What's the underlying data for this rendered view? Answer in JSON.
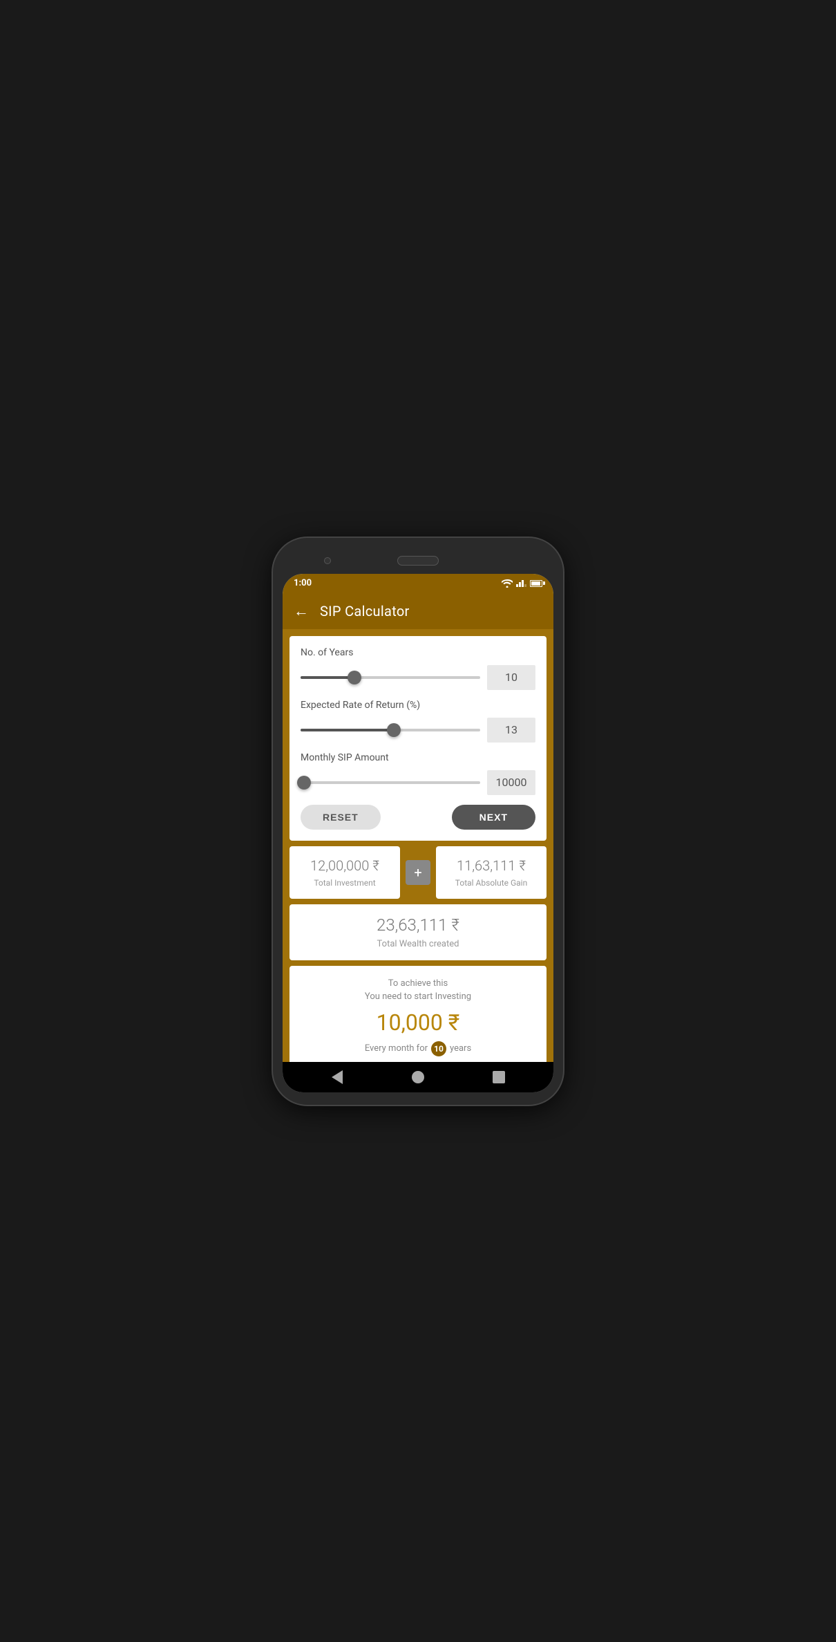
{
  "statusBar": {
    "time": "1:00",
    "wifiIcon": "wifi",
    "signalIcon": "signal",
    "batteryIcon": "battery"
  },
  "appBar": {
    "backLabel": "←",
    "title": "SIP Calculator"
  },
  "calculator": {
    "fields": [
      {
        "label": "No. of Years",
        "sliderPercent": 30,
        "value": "10"
      },
      {
        "label": "Expected Rate of Return (%)",
        "sliderPercent": 52,
        "value": "13"
      },
      {
        "label": "Monthly SIP Amount",
        "sliderPercent": 2,
        "value": "10000"
      }
    ],
    "resetLabel": "RESET",
    "nextLabel": "NEXT"
  },
  "results": {
    "totalInvestment": {
      "amount": "12,00,000 ₹",
      "label": "Total Investment"
    },
    "plusSign": "+",
    "totalAbsoluteGain": {
      "amount": "11,63,111 ₹",
      "label": "Total Absolute Gain"
    },
    "totalWealth": {
      "amount": "23,63,111 ₹",
      "label": "Total Wealth created"
    }
  },
  "achieve": {
    "topText1": "To achieve this",
    "topText2": "You need to start Investing",
    "amount": "10,000 ₹",
    "bottomPrefix": "Every month for",
    "years": "10",
    "bottomSuffix": "years"
  }
}
